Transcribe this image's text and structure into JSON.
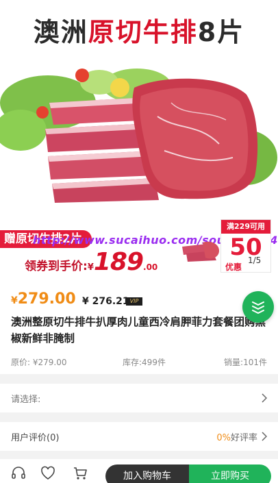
{
  "banner": {
    "title_part1": "澳洲",
    "title_part2": "原切牛排",
    "title_part3": "8片",
    "gift_tag": "赠原切牛排2片",
    "watermark": "http://www.sucaihuo.com/source/11/4",
    "coupon_label": "领券到手价:",
    "coupon_currency": "¥",
    "coupon_price_int": "189",
    "coupon_price_dec": ".00",
    "badge_top": "满229可用",
    "badge_value": "50",
    "badge_foot": "优惠",
    "page_indicator": "1/5"
  },
  "product": {
    "currency": "¥",
    "price": "279.00",
    "vip_price": "¥ 276.21",
    "vip_badge": "VIP",
    "title": "澳洲整原切牛排牛扒厚肉儿童西冷肩胛菲力套餐团购黑椒新鲜非腌制",
    "original_price": "原价: ¥279.00",
    "stock": "库存:499件",
    "sales": "销量:101件"
  },
  "rows": {
    "select_label": "请选择:",
    "review_label": "用户评价(0)",
    "review_percent": "0%",
    "review_suffix": "好评率"
  },
  "bottom_bar": {
    "add_to_cart": "加入购物车",
    "buy_now": "立即购买"
  },
  "colors": {
    "accent_green": "#20b35a",
    "price_orange": "#f08c16",
    "promo_red": "#e41c3a"
  }
}
